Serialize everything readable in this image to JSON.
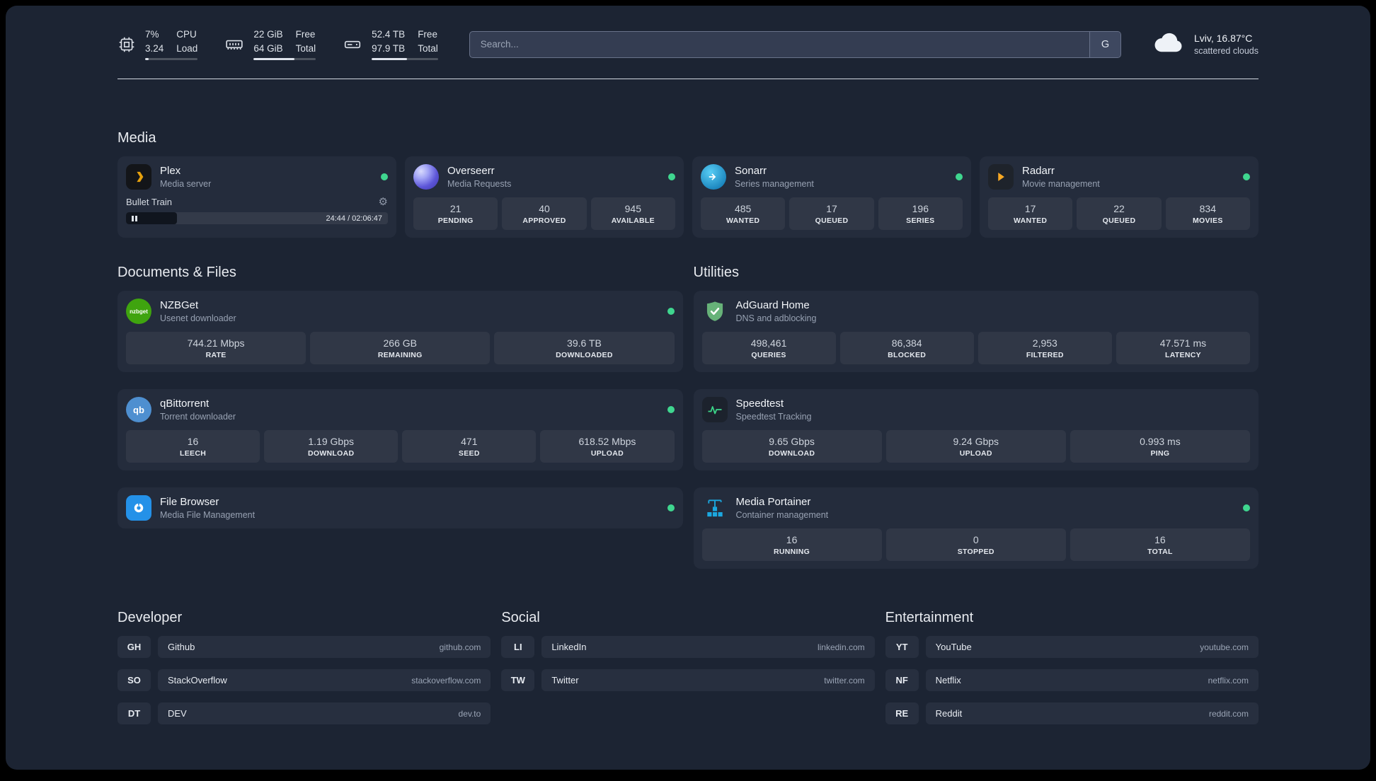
{
  "topbar": {
    "cpu": {
      "usage": "7%",
      "load": "3.24",
      "label_top": "CPU",
      "label_bottom": "Load"
    },
    "memory": {
      "free": "22 GiB",
      "total": "64 GiB",
      "label_top": "Free",
      "label_bottom": "Total"
    },
    "disk": {
      "free": "52.4 TB",
      "total": "97.9 TB",
      "label_top": "Free",
      "label_bottom": "Total"
    },
    "search": {
      "placeholder": "Search...",
      "provider_initial": "G"
    },
    "weather": {
      "location": "Lviv, 16.87°C",
      "condition": "scattered clouds"
    }
  },
  "icons": {
    "gear_glyph": "⚙",
    "nzbget_text": "nzbget",
    "qb_text": "qb"
  },
  "colors": {
    "status_online": "#3fd68f",
    "background": "#1c2433",
    "card": "#242c3c"
  },
  "sections": {
    "media": {
      "title": "Media",
      "cards": {
        "plex": {
          "name": "Plex",
          "desc": "Media server",
          "now_playing": "Bullet Train",
          "time": "24:44 / 02:06:47"
        },
        "overseerr": {
          "name": "Overseerr",
          "desc": "Media Requests",
          "stats": [
            {
              "value": "21",
              "label": "PENDING"
            },
            {
              "value": "40",
              "label": "APPROVED"
            },
            {
              "value": "945",
              "label": "AVAILABLE"
            }
          ]
        },
        "sonarr": {
          "name": "Sonarr",
          "desc": "Series management",
          "stats": [
            {
              "value": "485",
              "label": "WANTED"
            },
            {
              "value": "17",
              "label": "QUEUED"
            },
            {
              "value": "196",
              "label": "SERIES"
            }
          ]
        },
        "radarr": {
          "name": "Radarr",
          "desc": "Movie management",
          "stats": [
            {
              "value": "17",
              "label": "WANTED"
            },
            {
              "value": "22",
              "label": "QUEUED"
            },
            {
              "value": "834",
              "label": "MOVIES"
            }
          ]
        }
      }
    },
    "documents": {
      "title": "Documents & Files",
      "cards": {
        "nzbget": {
          "name": "NZBGet",
          "desc": "Usenet downloader",
          "stats": [
            {
              "value": "744.21 Mbps",
              "label": "RATE"
            },
            {
              "value": "266 GB",
              "label": "REMAINING"
            },
            {
              "value": "39.6 TB",
              "label": "DOWNLOADED"
            }
          ]
        },
        "qbittorrent": {
          "name": "qBittorrent",
          "desc": "Torrent downloader",
          "stats": [
            {
              "value": "16",
              "label": "LEECH"
            },
            {
              "value": "1.19 Gbps",
              "label": "DOWNLOAD"
            },
            {
              "value": "471",
              "label": "SEED"
            },
            {
              "value": "618.52 Mbps",
              "label": "UPLOAD"
            }
          ]
        },
        "filebrowser": {
          "name": "File Browser",
          "desc": "Media File Management"
        }
      }
    },
    "utilities": {
      "title": "Utilities",
      "cards": {
        "adguard": {
          "name": "AdGuard Home",
          "desc": "DNS and adblocking",
          "stats": [
            {
              "value": "498,461",
              "label": "QUERIES"
            },
            {
              "value": "86,384",
              "label": "BLOCKED"
            },
            {
              "value": "2,953",
              "label": "FILTERED"
            },
            {
              "value": "47.571 ms",
              "label": "LATENCY"
            }
          ]
        },
        "speedtest": {
          "name": "Speedtest",
          "desc": "Speedtest Tracking",
          "stats": [
            {
              "value": "9.65 Gbps",
              "label": "DOWNLOAD"
            },
            {
              "value": "9.24 Gbps",
              "label": "UPLOAD"
            },
            {
              "value": "0.993 ms",
              "label": "PING"
            }
          ]
        },
        "portainer": {
          "name": "Media Portainer",
          "desc": "Container management",
          "stats": [
            {
              "value": "16",
              "label": "RUNNING"
            },
            {
              "value": "0",
              "label": "STOPPED"
            },
            {
              "value": "16",
              "label": "TOTAL"
            }
          ]
        }
      }
    },
    "bookmarks": {
      "developer": {
        "title": "Developer",
        "items": [
          {
            "abbr": "GH",
            "name": "Github",
            "domain": "github.com"
          },
          {
            "abbr": "SO",
            "name": "StackOverflow",
            "domain": "stackoverflow.com"
          },
          {
            "abbr": "DT",
            "name": "DEV",
            "domain": "dev.to"
          }
        ]
      },
      "social": {
        "title": "Social",
        "items": [
          {
            "abbr": "LI",
            "name": "LinkedIn",
            "domain": "linkedin.com"
          },
          {
            "abbr": "TW",
            "name": "Twitter",
            "domain": "twitter.com"
          }
        ]
      },
      "entertainment": {
        "title": "Entertainment",
        "items": [
          {
            "abbr": "YT",
            "name": "YouTube",
            "domain": "youtube.com"
          },
          {
            "abbr": "NF",
            "name": "Netflix",
            "domain": "netflix.com"
          },
          {
            "abbr": "RE",
            "name": "Reddit",
            "domain": "reddit.com"
          }
        ]
      }
    }
  }
}
